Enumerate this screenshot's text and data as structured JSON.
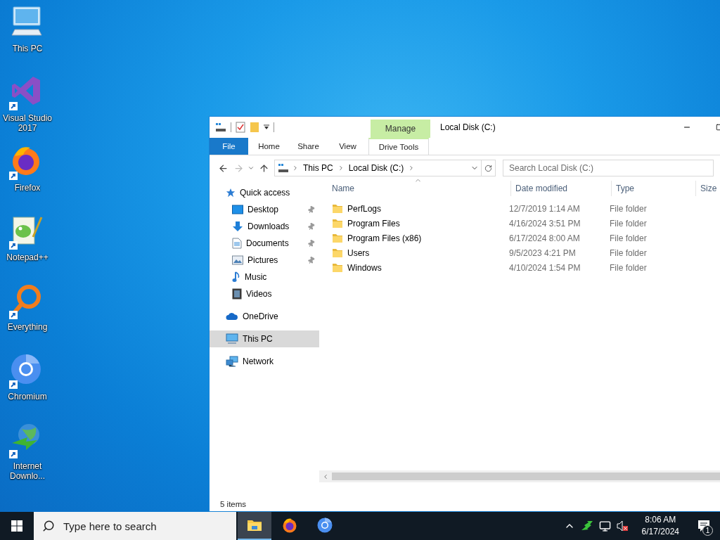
{
  "desktop_icons": [
    {
      "label": "This PC",
      "kind": "pc",
      "shortcut": false
    },
    {
      "label": "Visual Studio 2017",
      "kind": "vs",
      "shortcut": true
    },
    {
      "label": "Firefox",
      "kind": "firefox",
      "shortcut": true
    },
    {
      "label": "Notepad++",
      "kind": "notepad",
      "shortcut": true
    },
    {
      "label": "Everything",
      "kind": "everything",
      "shortcut": true
    },
    {
      "label": "Chromium",
      "kind": "chromium",
      "shortcut": true
    },
    {
      "label": "Internet Downlo...",
      "kind": "idm",
      "shortcut": true
    }
  ],
  "explorer": {
    "context_tab": "Manage",
    "title": "Local Disk (C:)",
    "ribbon_tabs": [
      {
        "label": "File",
        "kind": "file"
      },
      {
        "label": "Home",
        "kind": "tab"
      },
      {
        "label": "Share",
        "kind": "tab"
      },
      {
        "label": "View",
        "kind": "tab"
      },
      {
        "label": "Drive Tools",
        "kind": "context"
      }
    ],
    "address": [
      "This PC",
      "Local Disk (C:)"
    ],
    "search": {
      "placeholder": "Search Local Disk (C:)"
    },
    "nav": [
      {
        "label": "Quick access",
        "kind": "quick",
        "selected": false,
        "children": [
          {
            "label": "Desktop",
            "kind": "desktop",
            "pinned": true,
            "selected": false
          },
          {
            "label": "Downloads",
            "kind": "downloads",
            "pinned": true,
            "selected": false
          },
          {
            "label": "Documents",
            "kind": "documents",
            "pinned": true,
            "selected": false
          },
          {
            "label": "Pictures",
            "kind": "pictures",
            "pinned": true,
            "selected": false
          },
          {
            "label": "Music",
            "kind": "music",
            "pinned": false,
            "selected": false
          },
          {
            "label": "Videos",
            "kind": "videos",
            "pinned": false,
            "selected": false
          }
        ]
      },
      {
        "label": "OneDrive",
        "kind": "onedrive",
        "selected": false
      },
      {
        "label": "This PC",
        "kind": "pc",
        "selected": true
      },
      {
        "label": "Network",
        "kind": "network",
        "selected": false
      }
    ],
    "columns": [
      "Name",
      "Date modified",
      "Type",
      "Size"
    ],
    "rows": [
      {
        "name": "PerfLogs",
        "date": "12/7/2019 1:14 AM",
        "type": "File folder",
        "selected": false
      },
      {
        "name": "Program Files",
        "date": "4/16/2024 3:51 PM",
        "type": "File folder",
        "selected": false
      },
      {
        "name": "Program Files (x86)",
        "date": "6/17/2024 8:00 AM",
        "type": "File folder",
        "selected": false
      },
      {
        "name": "Users",
        "date": "9/5/2023 4:21 PM",
        "type": "File folder",
        "selected": false
      },
      {
        "name": "Windows",
        "date": "4/10/2024 1:54 PM",
        "type": "File folder",
        "selected": false
      }
    ],
    "status": "5 items"
  },
  "taskbar": {
    "search": {
      "placeholder": "Type here to search"
    },
    "apps": [
      {
        "kind": "explorer",
        "selected": true
      },
      {
        "kind": "firefox",
        "selected": false
      },
      {
        "kind": "chromium",
        "selected": false
      }
    ],
    "time": "8:06 AM",
    "date": "6/17/2024",
    "notifications": "1"
  }
}
